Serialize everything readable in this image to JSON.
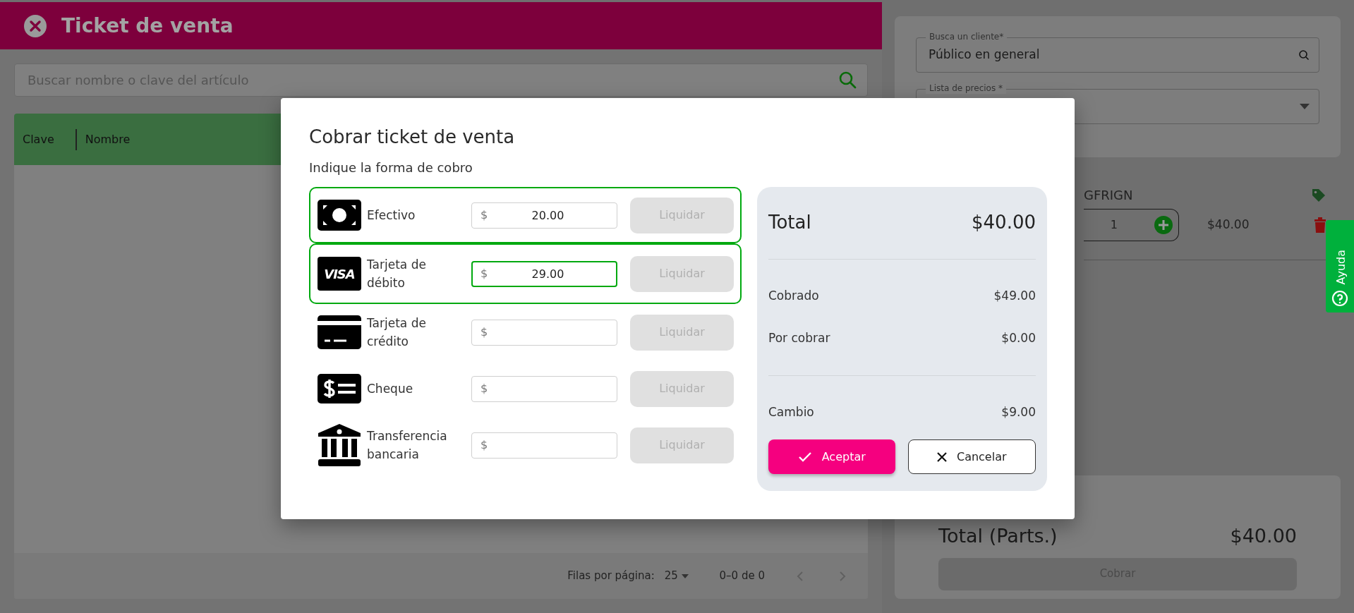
{
  "ticket": {
    "title": "Ticket de venta",
    "search": {
      "placeholder": "Buscar nombre o clave del artículo"
    },
    "table": {
      "columns": [
        "Clave",
        "Nombre"
      ]
    },
    "pagination": {
      "rows_per_page_label": "Filas por página:",
      "rows_per_page": "25",
      "range": "0–0 de 0"
    }
  },
  "customer_panel": {
    "customer_field": {
      "label": "Busca un cliente*",
      "value": "Público en general"
    },
    "price_list_field": {
      "label": "Lista de precios *"
    }
  },
  "line_items": [
    {
      "code": "GFRIGN",
      "quantity": "1",
      "amount": "$40.00"
    }
  ],
  "totals_panel": {
    "label": "Total (Parts.)",
    "value": "$40.00",
    "button": "Cobrar"
  },
  "help_tab": {
    "label": "Ayuda"
  },
  "dialog": {
    "title": "Cobrar ticket de venta",
    "subtitle": "Indique la forma de cobro",
    "methods": [
      {
        "kind": "cash",
        "label": "Efectivo",
        "currency": "$",
        "value": "20.00",
        "highlighted": true,
        "focused": false,
        "button": "Liquidar",
        "disabled": true
      },
      {
        "kind": "card_logo",
        "logo": "VISA",
        "label": "Tarjeta de débito",
        "currency": "$",
        "value": "29.00",
        "highlighted": true,
        "focused": true,
        "button": "Liquidar",
        "disabled": true
      },
      {
        "kind": "credit_card",
        "label": "Tarjeta de crédito",
        "currency": "$",
        "highlighted": false,
        "focused": false,
        "button": "Liquidar",
        "disabled": true
      },
      {
        "kind": "cheque",
        "label": "Cheque",
        "currency": "$",
        "highlighted": false,
        "focused": false,
        "button": "Liquidar",
        "disabled": true
      },
      {
        "kind": "bank",
        "label": "Transferencia bancaria",
        "currency": "$",
        "highlighted": false,
        "focused": false,
        "button": "Liquidar",
        "disabled": true
      }
    ],
    "summary": {
      "total_label": "Total",
      "total": "$40.00",
      "groups": [
        [
          {
            "label": "Cobrado",
            "value": "$49.00"
          },
          {
            "label": "Por cobrar",
            "value": "$0.00"
          }
        ],
        [
          {
            "label": "Cambio",
            "value": "$9.00"
          }
        ]
      ],
      "accept_button": "Aceptar",
      "cancel_button": "Cancelar"
    }
  }
}
